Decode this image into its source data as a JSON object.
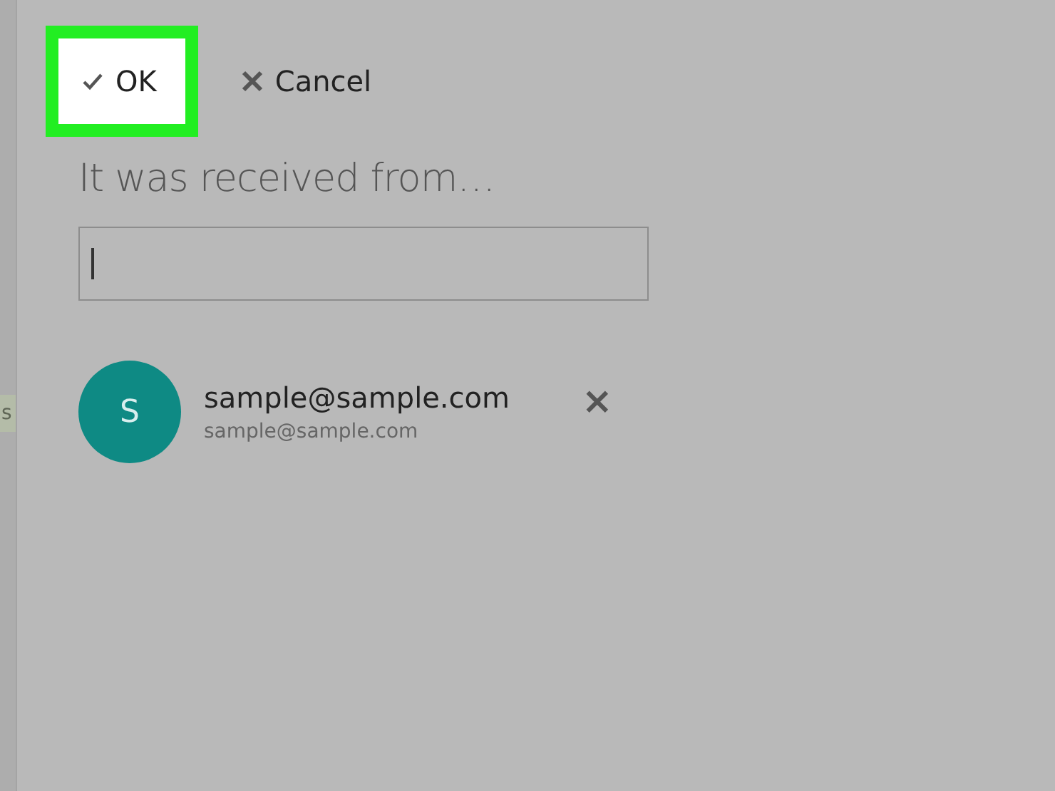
{
  "sidebar": {
    "fragment": "s"
  },
  "toolbar": {
    "buttons": [
      {
        "kind": "ok",
        "label": "OK",
        "highlighted": true
      },
      {
        "kind": "cancel",
        "label": "Cancel",
        "highlighted": false
      }
    ]
  },
  "heading": "It was received from…",
  "contacts": [
    {
      "initial": "S",
      "color": "#0e8a84",
      "name": "sample@sample.com",
      "email": "sample@sample.com",
      "remove": "×"
    }
  ]
}
